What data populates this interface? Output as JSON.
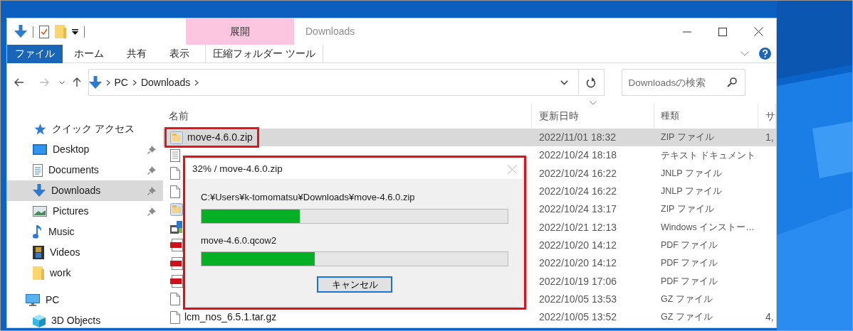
{
  "window": {
    "title": "Downloads"
  },
  "ribbon": {
    "context_group": "展開",
    "tabs": [
      {
        "label": "ファイル",
        "kind": "file",
        "selected": false
      },
      {
        "label": "ホーム",
        "kind": "tab",
        "selected": false
      },
      {
        "label": "共有",
        "kind": "tab",
        "selected": false
      },
      {
        "label": "表示",
        "kind": "tab",
        "selected": false
      },
      {
        "label": "圧縮フォルダー ツール",
        "kind": "context",
        "selected": false
      }
    ]
  },
  "address": {
    "path": [
      "PC",
      "Downloads"
    ]
  },
  "search": {
    "placeholder": "Downloadsの検索"
  },
  "sidebar": {
    "items": [
      {
        "label": "クイック アクセス",
        "kind": "star",
        "selected": false,
        "children": [
          {
            "label": "Desktop",
            "kind": "desktop",
            "pinned": true,
            "selected": false
          },
          {
            "label": "Documents",
            "kind": "documents",
            "pinned": true,
            "selected": false
          },
          {
            "label": "Downloads",
            "kind": "downloads",
            "pinned": true,
            "selected": true
          },
          {
            "label": "Pictures",
            "kind": "pictures",
            "pinned": true,
            "selected": false
          },
          {
            "label": "Music",
            "kind": "music",
            "pinned": false,
            "selected": false
          },
          {
            "label": "Videos",
            "kind": "videos",
            "pinned": false,
            "selected": false
          },
          {
            "label": "work",
            "kind": "folder",
            "pinned": false,
            "selected": false
          }
        ]
      },
      {
        "label": "PC",
        "kind": "pc",
        "selected": false,
        "children": [
          {
            "label": "3D Objects",
            "kind": "objects3d",
            "pinned": false,
            "selected": false
          }
        ]
      }
    ]
  },
  "file_list": {
    "columns": [
      {
        "label": "名前",
        "sorted": false
      },
      {
        "label": "更新日時",
        "sorted": true
      },
      {
        "label": "種類",
        "sorted": false
      },
      {
        "label": "サ",
        "sorted": false
      }
    ],
    "rows": [
      {
        "name": "move-4.6.0.zip",
        "modified": "2022/11/01 18:32",
        "type": "ZIP ファイル",
        "column_4": "1,",
        "kind": "zip",
        "selected": true,
        "highlighted": true
      },
      {
        "modified": "2022/10/24 18:18",
        "type": "テキスト ドキュメント",
        "kind": "text",
        "selected": false,
        "highlighted": false
      },
      {
        "modified": "2022/10/24 16:22",
        "type": "JNLP ファイル",
        "kind": "file",
        "selected": false,
        "highlighted": false
      },
      {
        "modified": "2022/10/24 16:22",
        "type": "JNLP ファイル",
        "kind": "file",
        "selected": false,
        "highlighted": false
      },
      {
        "modified": "2022/10/24 13:17",
        "type": "ZIP ファイル",
        "kind": "zip",
        "selected": false,
        "highlighted": false
      },
      {
        "modified": "2022/10/21 12:13",
        "type": "Windows インストー…",
        "kind": "msi",
        "selected": false,
        "highlighted": false
      },
      {
        "modified": "2022/10/20 14:12",
        "type": "PDF ファイル",
        "kind": "pdf",
        "selected": false,
        "highlighted": false
      },
      {
        "modified": "2022/10/20 14:12",
        "type": "PDF ファイル",
        "kind": "pdf",
        "selected": false,
        "highlighted": false
      },
      {
        "modified": "2022/10/19 17:06",
        "type": "PDF ファイル",
        "kind": "pdf",
        "selected": false,
        "highlighted": false
      },
      {
        "modified": "2022/10/05 13:53",
        "type": "GZ ファイル",
        "kind": "file",
        "selected": false,
        "highlighted": false
      },
      {
        "name": "lcm_nos_6.5.1.tar.gz",
        "modified": "2022/10/05 13:52",
        "type": "GZ ファイル",
        "column_4": "4,",
        "kind": "file",
        "selected": false,
        "highlighted": false
      }
    ]
  },
  "dialog": {
    "title": "32% / move-4.6.0.zip",
    "highlighted": true,
    "items": [
      {
        "label": "C:¥Users¥k-tomomatsu¥Downloads¥move-4.6.0.zip",
        "level": 0.32
      },
      {
        "label": "move-4.6.0.qcow2",
        "level": 0.37
      }
    ],
    "cancel_button": "キャンセル"
  }
}
